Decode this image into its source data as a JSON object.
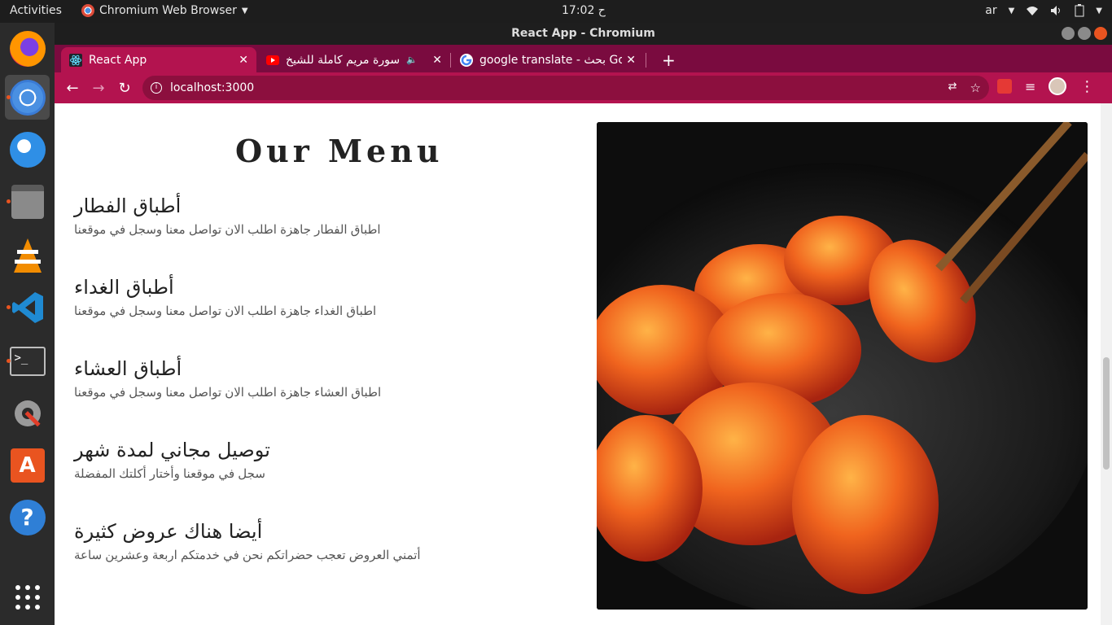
{
  "topbar": {
    "activities": "Activities",
    "app_name": "Chromium Web Browser",
    "clock": "17:02 ح",
    "lang": "ar"
  },
  "window": {
    "title": "React App - Chromium"
  },
  "tabs": [
    {
      "label": "React App"
    },
    {
      "label": "سورة مريم كاملة للشيخ"
    },
    {
      "label": "google translate - بحث Go"
    }
  ],
  "omnibox": {
    "url": "localhost:3000"
  },
  "page": {
    "title": "Our Menu",
    "items": [
      {
        "heading": "أطباق الفطار",
        "desc": "اطباق الفطار جاهزة اطلب الان تواصل معنا وسجل في موقعنا"
      },
      {
        "heading": "أطباق الغداء",
        "desc": "اطباق الغداء جاهزة اطلب الان تواصل معنا وسجل في موقعنا"
      },
      {
        "heading": "أطباق العشاء",
        "desc": "اطباق العشاء جاهزة اطلب الان تواصل معنا وسجل في موقعنا"
      },
      {
        "heading": "توصيل مجاني لمدة شهر",
        "desc": "سجل في موقعنا وأختار أكلتك المفضلة"
      },
      {
        "heading": "أيضا هناك عروض كثيرة",
        "desc": "أتمني العروض تعجب حضراتكم نحن في خدمتكم اربعة وعشرين ساعة"
      }
    ]
  },
  "colors": {
    "tabstrip": "#7a0b3f",
    "toolbar": "#b3134f",
    "ubuntu_orange": "#e95420"
  }
}
